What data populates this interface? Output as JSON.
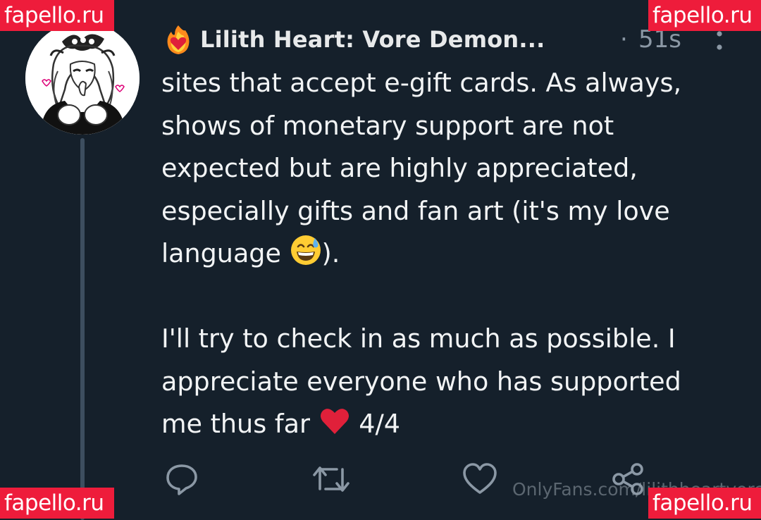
{
  "tweet": {
    "display_name": "Lilith Heart: Vore Demon...",
    "separator": "·",
    "timestamp": "51s",
    "text_lines": [
      "sites that accept e-gift cards. As always,",
      "shows of monetary support are not",
      "expected but are highly appreciated,",
      "especially gifts and fan art (it's my love"
    ],
    "line5_before": "language ",
    "line5_after": ").",
    "para2_lines": [
      "I'll try to check in as much as possible. I",
      "appreciate everyone who has supported"
    ],
    "last_line_before": "me thus far ",
    "last_line_after": " 4/4"
  },
  "actions": {
    "reply_icon": "reply-icon",
    "retweet_icon": "retweet-icon",
    "like_icon": "heart-icon",
    "share_icon": "share-icon"
  },
  "icons": {
    "avatar": "avatar",
    "name_emoji": "fire-heart-emoji",
    "more": "more-vertical-icon",
    "inline_emoji_1": "grinning-sweat-emoji",
    "inline_emoji_2": "red-heart-emoji"
  },
  "watermarks": {
    "corner_text": "fapello.ru",
    "overlay_text": "OnlyFans.com/lilithheartvore"
  },
  "colors": {
    "background": "#15202b",
    "text": "#e7e9ea",
    "muted": "#8b98a5",
    "watermark_bg": "#ee1c3b",
    "heart": "#e0203a"
  }
}
